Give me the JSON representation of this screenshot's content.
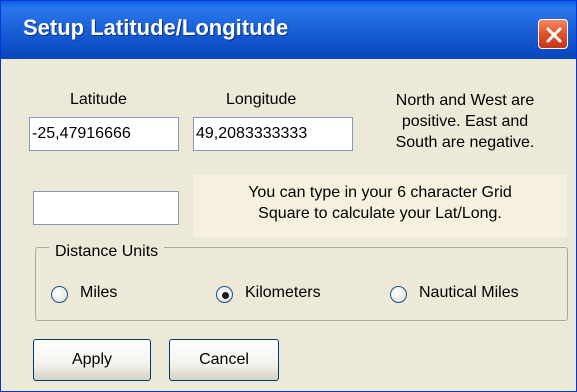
{
  "window": {
    "title": "Setup Latitude/Longitude",
    "close_icon": "close-icon"
  },
  "latitude": {
    "label": "Latitude",
    "value": "-25,47916666"
  },
  "longitude": {
    "label": "Longitude",
    "value": "49,2083333333"
  },
  "note": {
    "lines": [
      "North and West are",
      "positive.  East and",
      "South are negative."
    ]
  },
  "grid": {
    "value": "",
    "lines": [
      "You can type in your 6 character Grid",
      "Square to calculate your Lat/Long."
    ]
  },
  "units": {
    "legend": "Distance Units",
    "options": [
      {
        "label": "Miles",
        "selected": false
      },
      {
        "label": "Kilometers",
        "selected": true
      },
      {
        "label": "Nautical Miles",
        "selected": false
      }
    ]
  },
  "buttons": {
    "apply": "Apply",
    "cancel": "Cancel"
  }
}
